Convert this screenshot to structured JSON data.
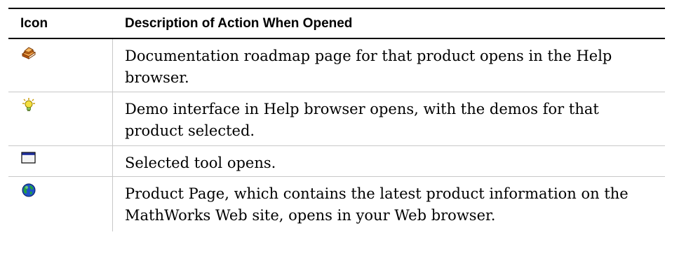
{
  "table": {
    "headers": {
      "icon": "Icon",
      "description": "Description of Action When Opened"
    },
    "rows": [
      {
        "icon": "book-icon",
        "description": "Documentation roadmap page for that product opens in the Help browser."
      },
      {
        "icon": "lightbulb-icon",
        "description": "Demo interface in Help browser opens, with the demos for that product selected."
      },
      {
        "icon": "window-icon",
        "description": "Selected tool opens."
      },
      {
        "icon": "globe-icon",
        "description": "Product Page, which contains the latest product information on the MathWorks Web site, opens in your Web browser."
      }
    ]
  },
  "colors": {
    "rule": "#000000",
    "grid": "#c8c8c8",
    "book": "#e07818",
    "bulb": "#f4e040",
    "globe": "#2050c8",
    "land": "#20a040"
  }
}
